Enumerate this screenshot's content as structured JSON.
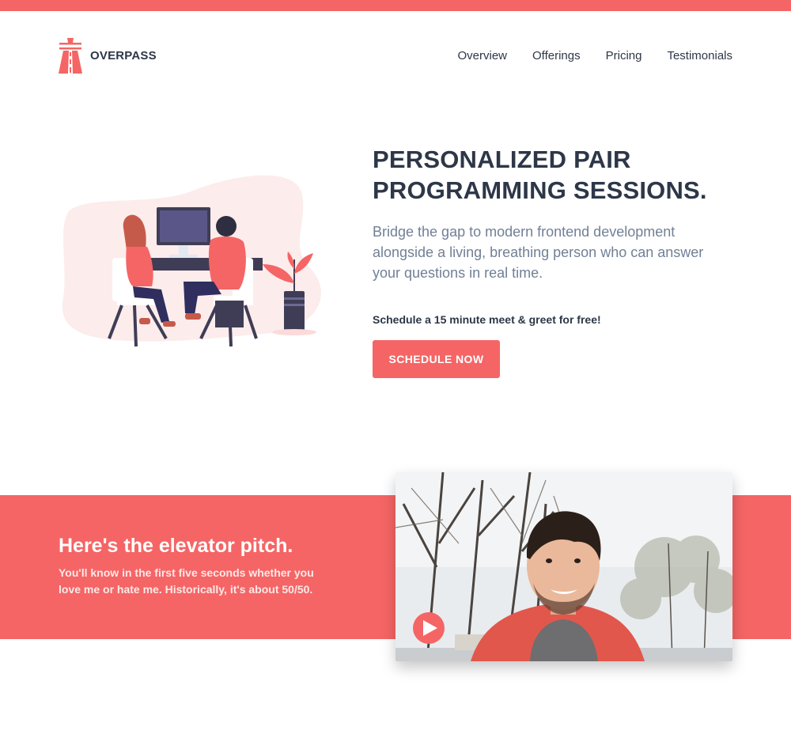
{
  "colors": {
    "accent": "#f56565",
    "heading": "#2d3748",
    "muted": "#718096"
  },
  "brand": {
    "name": "OVERPASS",
    "logo_icon": "highway-overpass-icon"
  },
  "nav": {
    "items": [
      {
        "label": "Overview"
      },
      {
        "label": "Offerings"
      },
      {
        "label": "Pricing"
      },
      {
        "label": "Testimonials"
      }
    ]
  },
  "hero": {
    "title_line1": "PERSONALIZED PAIR",
    "title_line2": "PROGRAMMING SESSIONS.",
    "subtitle": "Bridge the gap to modern frontend development alongside a living, breathing person who can answer your questions in real time.",
    "cta_caption": "Schedule a 15 minute meet & greet for free!",
    "cta_button": "SCHEDULE NOW",
    "illustration": "pair-programming-illustration"
  },
  "pitch": {
    "heading": "Here's the elevator pitch.",
    "text": "You'll know in the first five seconds whether you love me or hate me. Historically, it's about 50/50.",
    "video_thumbnail": "smiling-man-outdoors-video-thumbnail",
    "play_icon": "play-icon"
  }
}
